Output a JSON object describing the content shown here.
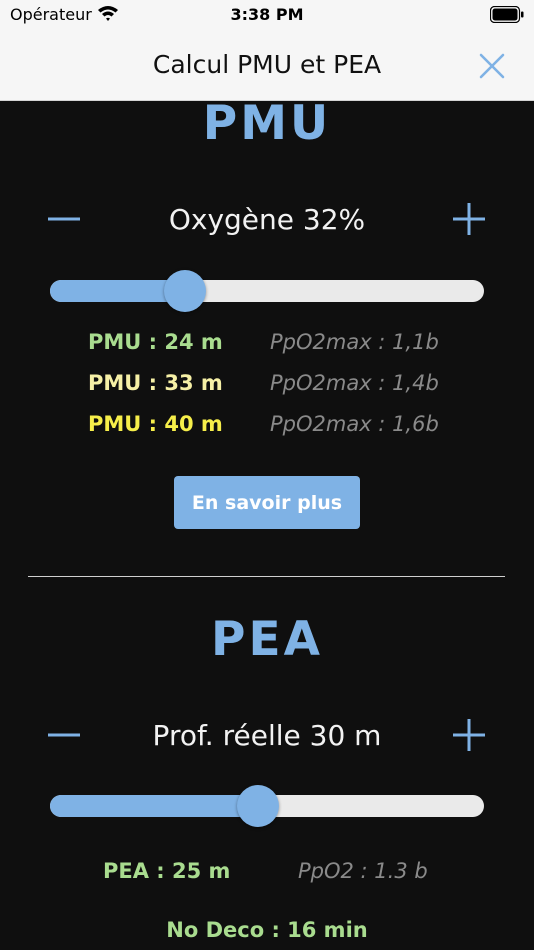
{
  "status_bar": {
    "carrier": "Opérateur",
    "time": "3:38 PM"
  },
  "nav": {
    "title": "Calcul PMU et PEA",
    "close_icon": "close-icon"
  },
  "colors": {
    "accent": "#7fb2e5",
    "green": "#a9dc8f",
    "light_yellow": "#f6f0a6",
    "yellow": "#f6ee4a",
    "muted": "#8a8a8a"
  },
  "pmu": {
    "title": "PMU",
    "gas_label": "Oxygène 32%",
    "slider_fraction": 0.31,
    "results": [
      {
        "label": "PMU : 24 m",
        "ppo2": "PpO2max : 1,1b"
      },
      {
        "label": "PMU : 33 m",
        "ppo2": "PpO2max : 1,4b"
      },
      {
        "label": "PMU : 40 m",
        "ppo2": "PpO2max : 1,6b"
      }
    ],
    "button_label": "En savoir plus"
  },
  "pea": {
    "title": "PEA",
    "depth_label": "Prof. réelle 30 m",
    "slider_fraction": 0.48,
    "result_label": "PEA : 25  m",
    "ppo2": "PpO2 : 1.3 b",
    "no_deco": "No Deco : 16 min"
  }
}
